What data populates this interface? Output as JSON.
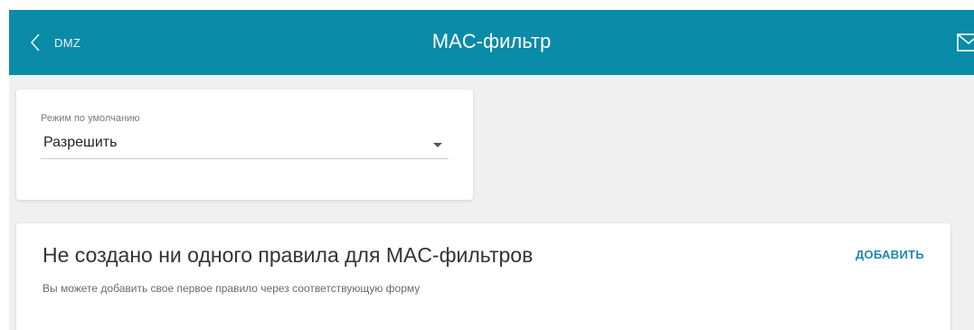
{
  "header": {
    "back_label": "DMZ",
    "title": "MAC-фильтр",
    "back_icon": "chevron-left-icon",
    "mail_icon": "envelope-icon",
    "bg_color": "#0a8ba8"
  },
  "default_mode": {
    "label": "Режим по умолчанию",
    "value": "Разрешить",
    "caret_icon": "caret-down-icon"
  },
  "rules": {
    "empty_title": "Не создано ни одного правила для MAC-фильтров",
    "empty_hint": "Вы можете добавить свое первое правило через соответствующую форму",
    "add_label": "ДОБАВИТЬ",
    "accent_color": "#1e88b4"
  }
}
